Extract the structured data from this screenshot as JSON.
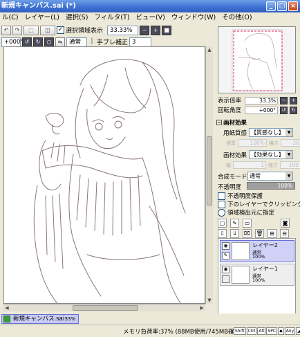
{
  "window": {
    "title": "新規キャンバス.sai (*)",
    "controls": [
      "_",
      "□",
      "×"
    ]
  },
  "menu": [
    "ル(C)",
    "レイヤー(L)",
    "選択(S)",
    "フィルタ(T)",
    "ビュー(V)",
    "ウィンドウ(W)",
    "その他(O)"
  ],
  "toolbar1": {
    "show_selection_label": "選択領域表示",
    "zoom": "33.33%"
  },
  "toolbar2": {
    "rotation": "+000°",
    "blend": "通常",
    "stabilizer_label": "手ブレ補正",
    "stabilizer_value": "3"
  },
  "navigator": {
    "zoom_label": "表示倍率",
    "zoom_value": "33.3%",
    "rotation_label": "回転角度",
    "rotation_value": "+000°"
  },
  "texture": {
    "section_title": "画材効果",
    "paper_label": "用紙質感",
    "paper_value": "【質感なし】",
    "paper_scale": "100%",
    "paper_strength": "20",
    "effect_label": "画材効果",
    "effect_value": "【効果なし】",
    "effect_width": "1",
    "effect_strength": "100"
  },
  "layer_props": {
    "blend_label": "合成モード",
    "blend_value": "通常",
    "opacity_label": "不透明度",
    "opacity_value": "100%",
    "opacity_fraction": 1.0,
    "check1": "不透明度保護",
    "check2": "下のレイヤーでクリッピング",
    "check3": "領域検出元に指定"
  },
  "layers": [
    {
      "name": "レイヤー2",
      "mode": "通常",
      "opacity": "100%",
      "selected": true
    },
    {
      "name": "レイヤー1",
      "mode": "通常",
      "opacity": "100%",
      "selected": false
    }
  ],
  "document_tab": {
    "name": "新規キャンバス.sai",
    "zoom": "33%"
  },
  "status": {
    "memory": "メモリ負荷率:37% (88MB使用/745MB確保)",
    "keys": [
      "Shift",
      "Ctrl",
      "Alt",
      "SPC",
      "◆",
      "Any",
      "◢"
    ]
  }
}
